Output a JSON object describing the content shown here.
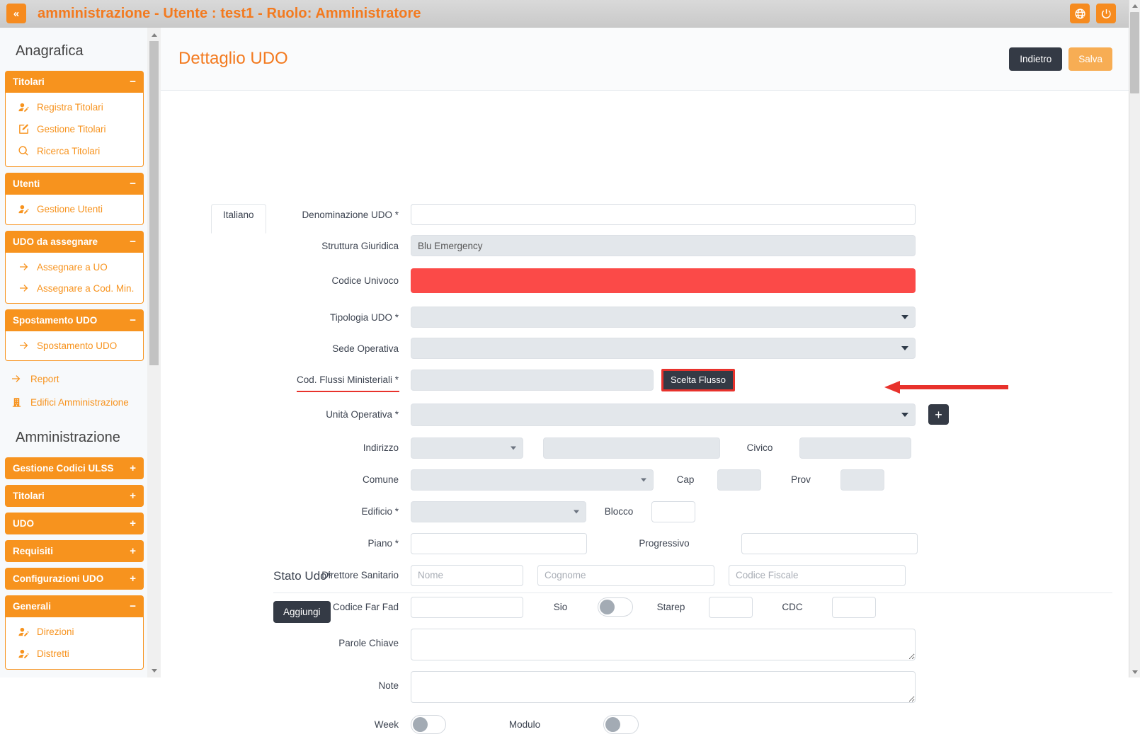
{
  "topbar": {
    "collapse_label": "«",
    "title": "amministrazione - Utente : test1 - Ruolo: Amministratore",
    "language_icon": "globe-icon",
    "logout_icon": "power-icon"
  },
  "sidebar": {
    "sections": [
      {
        "title": "Anagrafica",
        "groups": [
          {
            "label": "Titolari",
            "sign": "−",
            "expanded": true,
            "items": [
              {
                "label": "Registra Titolari",
                "icon": "user-edit-icon"
              },
              {
                "label": "Gestione Titolari",
                "icon": "pencil-square-icon"
              },
              {
                "label": "Ricerca Titolari",
                "icon": "search-icon"
              }
            ]
          },
          {
            "label": "Utenti",
            "sign": "−",
            "expanded": true,
            "items": [
              {
                "label": "Gestione Utenti",
                "icon": "user-edit-icon"
              }
            ]
          },
          {
            "label": "UDO da assegnare",
            "sign": "−",
            "expanded": true,
            "items": [
              {
                "label": "Assegnare a UO",
                "icon": "arrow-right-icon"
              },
              {
                "label": "Assegnare a Cod. Min.",
                "icon": "arrow-right-icon"
              }
            ]
          },
          {
            "label": "Spostamento UDO",
            "sign": "−",
            "expanded": true,
            "items": [
              {
                "label": "Spostamento UDO",
                "icon": "arrow-right-icon"
              }
            ]
          }
        ],
        "loose_items": [
          {
            "label": "Report",
            "icon": "arrow-right-icon"
          },
          {
            "label": "Edifici Amministrazione",
            "icon": "building-icon"
          }
        ]
      },
      {
        "title": "Amministrazione",
        "groups": [
          {
            "label": "Gestione Codici ULSS",
            "sign": "+",
            "expanded": false,
            "items": []
          },
          {
            "label": "Titolari",
            "sign": "+",
            "expanded": false,
            "items": []
          },
          {
            "label": "UDO",
            "sign": "+",
            "expanded": false,
            "items": []
          },
          {
            "label": "Requisiti",
            "sign": "+",
            "expanded": false,
            "items": []
          },
          {
            "label": "Configurazioni UDO",
            "sign": "+",
            "expanded": false,
            "items": []
          },
          {
            "label": "Generali",
            "sign": "−",
            "expanded": true,
            "items": [
              {
                "label": "Direzioni",
                "icon": "user-edit-icon"
              },
              {
                "label": "Distretti",
                "icon": "user-edit-icon"
              }
            ]
          }
        ],
        "loose_items": []
      }
    ]
  },
  "page": {
    "title": "Dettaglio UDO",
    "back_label": "Indietro",
    "save_label": "Salva"
  },
  "form": {
    "language_tab": "Italiano",
    "fields": {
      "denominazione_udo": {
        "label": "Denominazione UDO *",
        "value": "",
        "placeholder": ""
      },
      "struttura_giuridica": {
        "label": "Struttura Giuridica",
        "value": "Blu Emergency"
      },
      "codice_univoco": {
        "label": "Codice Univoco",
        "value": "",
        "state_color": "#fb4a48"
      },
      "tipologia_udo": {
        "label": "Tipologia UDO *",
        "value": ""
      },
      "sede_operativa": {
        "label": "Sede Operativa",
        "value": ""
      },
      "cod_flussi_ministeriali": {
        "label": "Cod. Flussi Ministeriali *",
        "value": "",
        "button_label": "Scelta Flusso"
      },
      "unita_operativa": {
        "label": "Unità Operativa *",
        "value": "",
        "add_label": "+"
      },
      "indirizzo": {
        "label": "Indirizzo",
        "prefix_value": "",
        "value": ""
      },
      "civico": {
        "label": "Civico",
        "value": ""
      },
      "comune": {
        "label": "Comune",
        "value": ""
      },
      "cap": {
        "label": "Cap",
        "value": ""
      },
      "prov": {
        "label": "Prov",
        "value": ""
      },
      "edificio": {
        "label": "Edificio *",
        "value": ""
      },
      "blocco": {
        "label": "Blocco",
        "value": ""
      },
      "piano": {
        "label": "Piano *",
        "value": ""
      },
      "progressivo": {
        "label": "Progressivo",
        "value": ""
      },
      "direttore_sanitario": {
        "label": "Direttore Sanitario",
        "nome_placeholder": "Nome",
        "cognome_placeholder": "Cognome",
        "codice_fiscale_placeholder": "Codice Fiscale",
        "nome_value": "",
        "cognome_value": "",
        "codice_fiscale_value": ""
      },
      "codice_far_fad": {
        "label": "Codice Far Fad",
        "value": ""
      },
      "sio": {
        "label": "Sio",
        "on": false
      },
      "starep": {
        "label": "Starep",
        "value": ""
      },
      "cdc": {
        "label": "CDC",
        "value": ""
      },
      "parole_chiave": {
        "label": "Parole Chiave",
        "value": ""
      },
      "note": {
        "label": "Note",
        "value": ""
      },
      "week": {
        "label": "Week",
        "on": false
      },
      "modulo": {
        "label": "Modulo",
        "on": false
      }
    },
    "annotations": {
      "highlight_color": "#e8322c",
      "arrow_target": "Scelta Flusso",
      "underlined_label": "Cod. Flussi Ministeriali *"
    }
  },
  "stato_udo": {
    "title": "Stato Udo*",
    "add_label": "Aggiungi"
  },
  "colors": {
    "brand_orange": "#f7931e",
    "title_orange": "#f37a1f",
    "dark_button": "#343a45",
    "save_orange": "#f7ad54",
    "error_red": "#fb4a48",
    "annotation_red": "#e8322c"
  }
}
